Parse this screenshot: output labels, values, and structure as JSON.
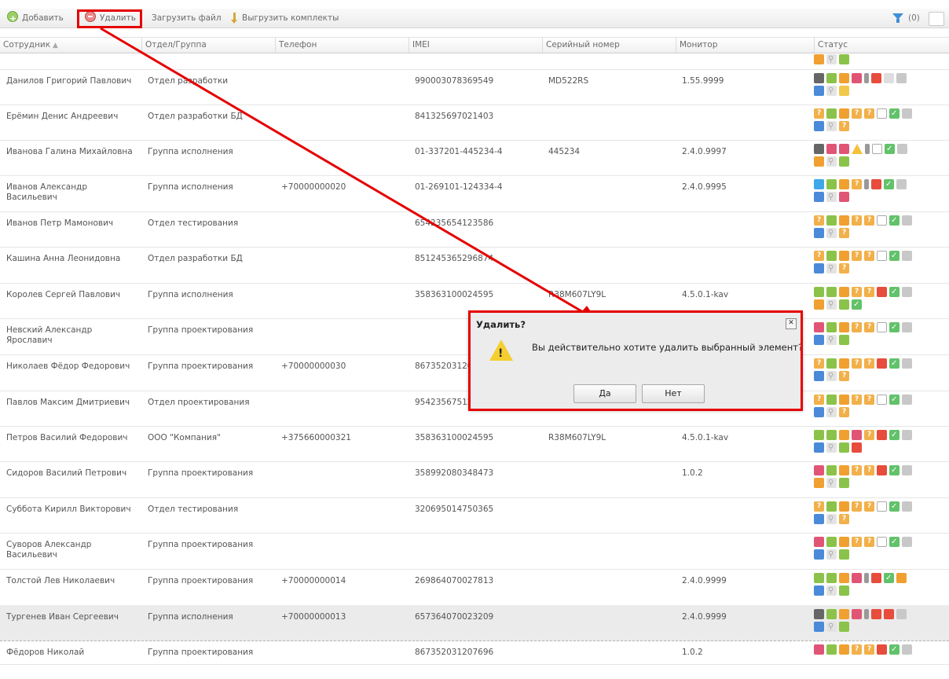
{
  "toolbar": {
    "add_label": "Добавить",
    "delete_label": "Удалить",
    "upload_label": "Загрузить файл",
    "export_label": "Выгрузить комплекты",
    "filter_count": "(0)"
  },
  "columns": [
    "Сотрудник",
    "Отдел/Группа",
    "Телефон",
    "IMEI",
    "Серийный номер",
    "Монитор",
    "Статус"
  ],
  "rows": [
    {
      "name": "Данилов Григорий Павлович",
      "dept": "Отдел разработки",
      "phone": "",
      "imei": "990003078369549",
      "serial": "MD522RS",
      "monitor": "1.55.9999"
    },
    {
      "name": "Ерёмин Денис Андреевич",
      "dept": "Отдел разработки БД",
      "phone": "",
      "imei": "841325697021403",
      "serial": "",
      "monitor": ""
    },
    {
      "name": "Иванова Галина Михайловна",
      "dept": "Группа исполнения",
      "phone": "",
      "imei": "01-337201-445234-4",
      "serial": "445234",
      "monitor": "2.4.0.9997"
    },
    {
      "name": "Иванов Александр Васильевич",
      "dept": "Группа исполнения",
      "phone": "+70000000020",
      "imei": "01-269101-124334-4",
      "serial": "",
      "monitor": "2.4.0.9995"
    },
    {
      "name": "Иванов Петр Мамонович",
      "dept": "Отдел тестирования",
      "phone": "",
      "imei": "654235654123586",
      "serial": "",
      "monitor": ""
    },
    {
      "name": "Кашина Анна Леонидовна",
      "dept": "Отдел разработки БД",
      "phone": "",
      "imei": "851245365296874",
      "serial": "",
      "monitor": ""
    },
    {
      "name": "Королев Сергей Павлович",
      "dept": "Группа исполнения",
      "phone": "",
      "imei": "358363100024595",
      "serial": "R38M607LY9L",
      "monitor": "4.5.0.1-kav"
    },
    {
      "name": "Невский Александр Ярославич",
      "dept": "Группа проектирования",
      "phone": "",
      "imei": "",
      "serial": "",
      "monitor": ""
    },
    {
      "name": "Николаев Фёдор Федорович",
      "dept": "Группа проектирования",
      "phone": "+70000000030",
      "imei": "867352031207696",
      "serial": "",
      "monitor": ""
    },
    {
      "name": "Павлов Максим Дмитриевич",
      "dept": "Отдел проектирования",
      "phone": "",
      "imei": "954235675124586",
      "serial": "",
      "monitor": ""
    },
    {
      "name": "Петров Василий Федорович",
      "dept": "ООО \"Компания\"",
      "phone": "+375660000321",
      "imei": "358363100024595",
      "serial": "R38M607LY9L",
      "monitor": "4.5.0.1-kav"
    },
    {
      "name": "Сидоров Василий Петрович",
      "dept": "Группа проектирования",
      "phone": "",
      "imei": "358992080348473",
      "serial": "",
      "monitor": "1.0.2"
    },
    {
      "name": "Суббота Кирилл Викторович",
      "dept": "Отдел тестирования",
      "phone": "",
      "imei": "320695014750365",
      "serial": "",
      "monitor": ""
    },
    {
      "name": "Суворов Александр Васильевич",
      "dept": "Группа проектирования",
      "phone": "",
      "imei": "",
      "serial": "",
      "monitor": ""
    },
    {
      "name": "Толстой Лев Николаевич",
      "dept": "Группа проектирования",
      "phone": "+70000000014",
      "imei": "269864070027813",
      "serial": "",
      "monitor": "2.4.0.9999"
    },
    {
      "name": "Тургенев Иван Сергеевич",
      "dept": "Группа исполнения",
      "phone": "+70000000013",
      "imei": "657364070023209",
      "serial": "",
      "monitor": "2.4.0.9999"
    },
    {
      "name": "Фёдоров Николай",
      "dept": "Группа проектирования",
      "phone": "",
      "imei": "867352031207696",
      "serial": "",
      "monitor": "1.0.2"
    }
  ],
  "dialog": {
    "title": "Удалить?",
    "message": "Вы действительно хотите удалить выбранный элемент?",
    "yes_label": "Да",
    "no_label": "Нет",
    "close_glyph": "✕"
  },
  "colors": {
    "highlight_red": "#e50000",
    "selected_row": "#ebebeb",
    "filter_blue": "#3f8fd8"
  }
}
